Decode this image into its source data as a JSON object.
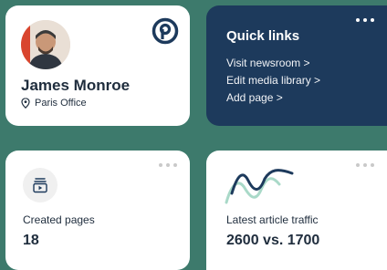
{
  "profile": {
    "name": "James Monroe",
    "office": "Paris Office",
    "icons": {
      "location": "location-pin-icon",
      "logo": "brand-logo-icon"
    }
  },
  "quick_links": {
    "title": "Quick links",
    "links": [
      {
        "label": "Visit newsroom >"
      },
      {
        "label": "Edit media library >"
      },
      {
        "label": "Add page >"
      }
    ]
  },
  "created_pages": {
    "label": "Created pages",
    "value": "18",
    "icon": "pages-icon"
  },
  "traffic": {
    "label": "Latest article traffic",
    "value": "2600 vs. 1700"
  },
  "colors": {
    "background": "#3d7a6c",
    "quick_links_bg": "#1d3a5c",
    "text": "#1f2d3d"
  }
}
